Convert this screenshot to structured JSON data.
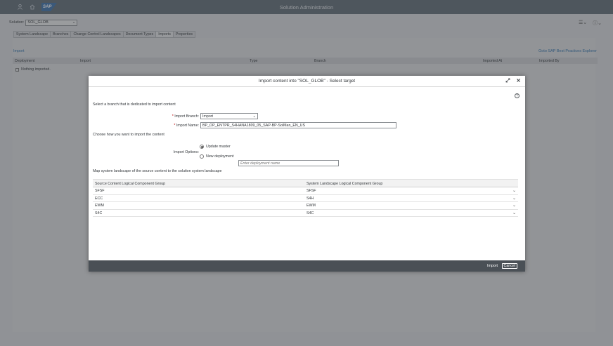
{
  "shell": {
    "title": "Solution Administration",
    "logo": "SAP",
    "icons": [
      "user-icon",
      "home-icon"
    ]
  },
  "toolbar": {
    "solution_label": "Solution:",
    "solution_value": "SOL_GLOB",
    "right_icons": [
      "list-settings-icon",
      "help-icon"
    ]
  },
  "tabs": [
    "System Landscape",
    "Branches",
    "Change Control Landscapes",
    "Document Types",
    "Imports",
    "Properties"
  ],
  "content": {
    "import_link": "Import",
    "goto_link": "Goto SAP Best Practices Explorer",
    "columns": [
      "Deployment",
      "Import",
      "Type",
      "Branch",
      "Imported At",
      "Imported By"
    ],
    "empty_text": "Nothing imported."
  },
  "dialog": {
    "title": "Import content into \"SOL_GLOB\" - Select target",
    "select_branch_text": "Select a branch that is dedicated to import content",
    "import_branch_label": "Import Branch:",
    "import_branch_value": "Import",
    "import_name_label": "Import Name:",
    "import_name_value": "BP_OP_ENTPR_S4HANA1809_05_SAP-BP-SolMan_EN_US",
    "choose_text": "Choose how you want to import the content",
    "import_options_label": "Import Options:",
    "option_update": "Update master",
    "option_new": "New deployment",
    "deployment_placeholder": "Enter deployment name",
    "map_text": "Map system landscape of the source content to the solution system landscape",
    "map_columns": [
      "Source Content Logical Component Group",
      "System Landscape Logical Component Group"
    ],
    "map_rows": [
      {
        "source": "SFSF",
        "target": "SFSF"
      },
      {
        "source": "ECC",
        "target": "S4H"
      },
      {
        "source": "EWM",
        "target": "EWM"
      },
      {
        "source": "S4C",
        "target": "S4C"
      }
    ],
    "import_button": "Import",
    "cancel_button": "Cancel"
  }
}
